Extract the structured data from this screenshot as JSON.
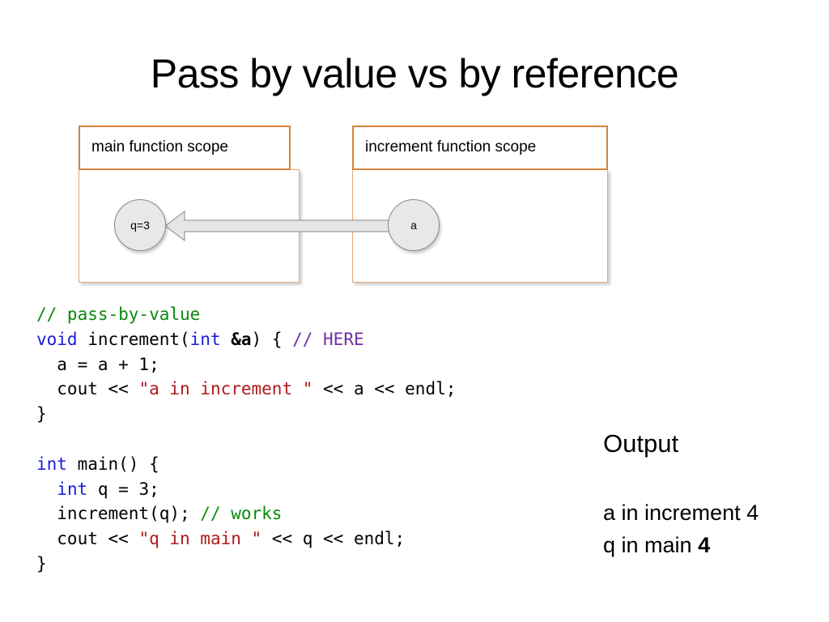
{
  "title": "Pass by value vs by reference",
  "diagram": {
    "main_scope": {
      "label": "main function scope",
      "variable": "q=3"
    },
    "increment_scope": {
      "label": "increment function scope",
      "variable": "a"
    },
    "arrow": {
      "from": "a",
      "to": "q=3",
      "direction": "left"
    },
    "colors": {
      "scope_border": "#d0843c",
      "circle_fill": "#e8e8e8"
    }
  },
  "code": {
    "lines": [
      {
        "comment": "// pass-by-value"
      },
      {
        "kw": "void",
        "name": " increment(",
        "param_kw": "int",
        "param": " &a",
        "rest": ") { ",
        "comment": "// HERE"
      },
      {
        "text": "  a = a + 1;"
      },
      {
        "pre": "  cout << ",
        "str": "\"a in increment \"",
        "post": " << a << endl;"
      },
      {
        "text": "}"
      },
      {
        "text": ""
      },
      {
        "kw": "int",
        "rest": " main() {"
      },
      {
        "indent": "  ",
        "kw": "int",
        "rest": " q = 3;"
      },
      {
        "text": "  increment(q); ",
        "comment": "// works"
      },
      {
        "pre": "  cout << ",
        "str": "\"q in main \"",
        "post": " << q << endl;"
      },
      {
        "text": "}"
      }
    ],
    "colors": {
      "keyword": "#1a1add",
      "comment": "#0b8a0b",
      "here_comment": "#7030a0",
      "string": "#b01a1a"
    }
  },
  "output": {
    "heading": "Output",
    "line1": "a in increment 4",
    "line2_text": "q in main ",
    "line2_value": "4"
  }
}
